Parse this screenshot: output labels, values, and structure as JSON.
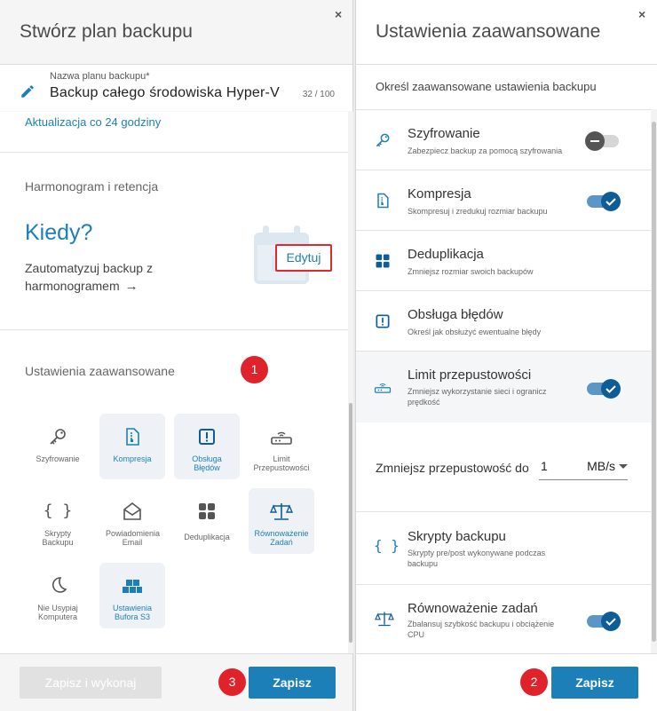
{
  "left": {
    "title": "Stwórz plan backupu",
    "close": "×",
    "plan_name_label": "Nazwa planu backupu*",
    "plan_name_value": "Backup całego środowiska Hyper-V",
    "plan_name_count": "32 / 100",
    "update_link": "Aktualizacja co 24 godziny",
    "schedule_title": "Harmonogram i retencja",
    "when_title": "Kiedy?",
    "when_desc": "Zautomatyzuj backup z harmonogramem",
    "advanced_title": "Ustawienia zaawansowane",
    "edit_label": "Edytuj",
    "tiles": [
      {
        "label": "Szyfrowanie",
        "icon": "key-icon",
        "active": false
      },
      {
        "label": "Kompresja",
        "icon": "compress-file-icon",
        "active": true
      },
      {
        "label": "Obsługa Błędów",
        "icon": "error-box-icon",
        "active": true
      },
      {
        "label": "Limit Przepustowości",
        "icon": "router-icon",
        "active": false
      },
      {
        "label": "Skrypty Backupu",
        "icon": "braces-icon",
        "active": false
      },
      {
        "label": "Powiadomienia Email",
        "icon": "envelope-icon",
        "active": false
      },
      {
        "label": "Deduplikacja",
        "icon": "grid-icon",
        "active": false
      },
      {
        "label": "Równoważenie Zadań",
        "icon": "scales-icon",
        "active": true
      },
      {
        "label": "Nie Usypiaj Komputera",
        "icon": "moon-icon",
        "active": false
      },
      {
        "label": "Ustawienia Bufora S3",
        "icon": "cubes-icon",
        "active": true
      }
    ],
    "btn_save_run": "Zapisz i wykonaj",
    "btn_save": "Zapisz"
  },
  "badges": {
    "one": "1",
    "two": "2",
    "three": "3"
  },
  "right": {
    "title": "Ustawienia zaawansowane",
    "close": "×",
    "subtitle": "Określ zaawansowane ustawienia backupu",
    "rows": [
      {
        "title": "Szyfrowanie",
        "desc": "Zabezpiecz backup za pomocą szyfrowania",
        "icon": "key-icon",
        "toggle": "off"
      },
      {
        "title": "Kompresja",
        "desc": "Skompresuj i zredukuj rozmiar backupu",
        "icon": "compress-file-icon",
        "toggle": "on"
      },
      {
        "title": "Deduplikacja",
        "desc": "Zmniejsz rozmiar swoich backupów",
        "icon": "grid-icon",
        "toggle": "none"
      },
      {
        "title": "Obsługa błędów",
        "desc": "Określ jak obsłużyć ewentualne błędy",
        "icon": "error-box-icon",
        "toggle": "none"
      },
      {
        "title": "Limit przepustowości",
        "desc": "Zmniejsz wykorzystanie sieci i ogranicz prędkość",
        "icon": "router-icon",
        "toggle": "on"
      },
      {
        "title": "Skrypty backupu",
        "desc": "Skrypty pre/post wykonywane podczas backupu",
        "icon": "braces-icon",
        "toggle": "none"
      },
      {
        "title": "Równoważenie zadań",
        "desc": "Zbalansuj szybkość backupu i obciążenie CPU",
        "icon": "scales-icon",
        "toggle": "on"
      }
    ],
    "bandwidth_label": "Zmniejsz przepustowość do",
    "bandwidth_value": "1",
    "bandwidth_unit": "MB/s",
    "btn_save": "Zapisz"
  },
  "colors": {
    "accent": "#1d7fb8",
    "badge": "#e0232a",
    "toggle_on": "#0f5d96"
  }
}
